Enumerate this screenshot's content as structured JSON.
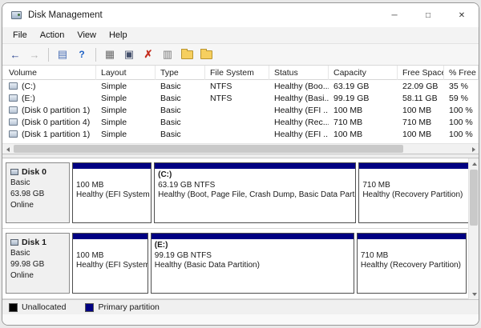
{
  "window": {
    "title": "Disk Management",
    "controls": {
      "minimize": "─",
      "maximize": "□",
      "close": "✕"
    }
  },
  "menubar": {
    "items": [
      "File",
      "Action",
      "View",
      "Help"
    ]
  },
  "toolbar": {
    "icons": [
      {
        "name": "back",
        "glyph": "←"
      },
      {
        "name": "forward",
        "glyph": "→"
      },
      {
        "name": "show-console-tree",
        "glyph": "▤"
      },
      {
        "name": "help",
        "glyph": "?"
      },
      {
        "name": "properties",
        "glyph": "▦"
      },
      {
        "name": "rescan-disks",
        "glyph": "▣"
      },
      {
        "name": "delete-volume",
        "glyph": "✗"
      },
      {
        "name": "format",
        "glyph": "▥"
      },
      {
        "name": "open-folder",
        "glyph": ""
      },
      {
        "name": "explore-folder",
        "glyph": ""
      }
    ]
  },
  "table": {
    "columns": [
      "Volume",
      "Layout",
      "Type",
      "File System",
      "Status",
      "Capacity",
      "Free Space",
      "% Free"
    ],
    "rows": [
      {
        "volume": "(C:)",
        "layout": "Simple",
        "type": "Basic",
        "file_system": "NTFS",
        "status": "Healthy (Boo...",
        "capacity": "63.19 GB",
        "free_space": "22.09 GB",
        "pct_free": "35 %"
      },
      {
        "volume": "(E:)",
        "layout": "Simple",
        "type": "Basic",
        "file_system": "NTFS",
        "status": "Healthy (Basi...",
        "capacity": "99.19 GB",
        "free_space": "58.11 GB",
        "pct_free": "59 %"
      },
      {
        "volume": "(Disk 0 partition 1)",
        "layout": "Simple",
        "type": "Basic",
        "file_system": "",
        "status": "Healthy (EFI ...",
        "capacity": "100 MB",
        "free_space": "100 MB",
        "pct_free": "100 %"
      },
      {
        "volume": "(Disk 0 partition 4)",
        "layout": "Simple",
        "type": "Basic",
        "file_system": "",
        "status": "Healthy (Rec...",
        "capacity": "710 MB",
        "free_space": "710 MB",
        "pct_free": "100 %"
      },
      {
        "volume": "(Disk 1 partition 1)",
        "layout": "Simple",
        "type": "Basic",
        "file_system": "",
        "status": "Healthy (EFI ...",
        "capacity": "100 MB",
        "free_space": "100 MB",
        "pct_free": "100 %"
      }
    ]
  },
  "disks": [
    {
      "name": "Disk 0",
      "kind": "Basic",
      "size": "63.98 GB",
      "state": "Online",
      "partitions": [
        {
          "label": "",
          "size": "100 MB",
          "status": "Healthy (EFI System P",
          "flex": 92
        },
        {
          "label": "(C:)",
          "size": "63.19 GB NTFS",
          "status": "Healthy (Boot, Page File, Crash Dump, Basic Data Partiti",
          "flex": 237
        },
        {
          "label": "",
          "size": "710 MB",
          "status": "Healthy (Recovery Partition)",
          "flex": 147
        }
      ]
    },
    {
      "name": "Disk 1",
      "kind": "Basic",
      "size": "99.98 GB",
      "state": "Online",
      "partitions": [
        {
          "label": "",
          "size": "100 MB",
          "status": "Healthy (EFI System P",
          "flex": 92
        },
        {
          "label": "(E:)",
          "size": "99.19 GB NTFS",
          "status": "Healthy (Basic Data Partition)",
          "flex": 250
        },
        {
          "label": "",
          "size": "710 MB",
          "status": "Healthy (Recovery Partition)",
          "flex": 134
        }
      ]
    }
  ],
  "colors": {
    "primary_partition": "#000082",
    "unallocated": "#000000"
  },
  "legend": {
    "items": [
      {
        "label": "Unallocated",
        "color": "#000000"
      },
      {
        "label": "Primary partition",
        "color": "#000082"
      }
    ]
  }
}
